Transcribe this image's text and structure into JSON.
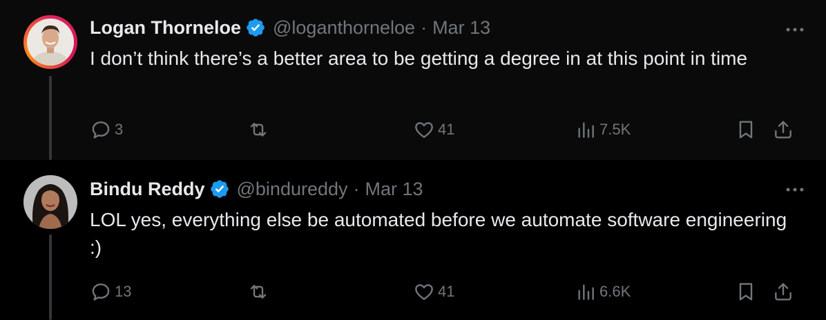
{
  "tweets": [
    {
      "name": "Logan Thorneloe",
      "handle": "@loganthorneloe",
      "separator": "·",
      "date": "Mar 13",
      "text": "I don’t think there’s a better area to be getting a degree in at this point in time",
      "replies": "3",
      "retweets": "",
      "likes": "41",
      "views": "7.5K"
    },
    {
      "name": "Bindu Reddy",
      "handle": "@bindureddy",
      "separator": "·",
      "date": "Mar 13",
      "text": "LOL yes, everything else be automated before we automate software engineering :)",
      "replies": "13",
      "retweets": "",
      "likes": "41",
      "views": "6.6K"
    }
  ],
  "colors": {
    "background": "#000000",
    "text": "#e7e9ea",
    "muted": "#71767b",
    "verified": "#1d9bf0",
    "thread_line": "#333639"
  },
  "icons": [
    "reply-icon",
    "retweet-icon",
    "like-icon",
    "views-icon",
    "bookmark-icon",
    "share-icon",
    "more-icon",
    "verified-badge-icon"
  ]
}
